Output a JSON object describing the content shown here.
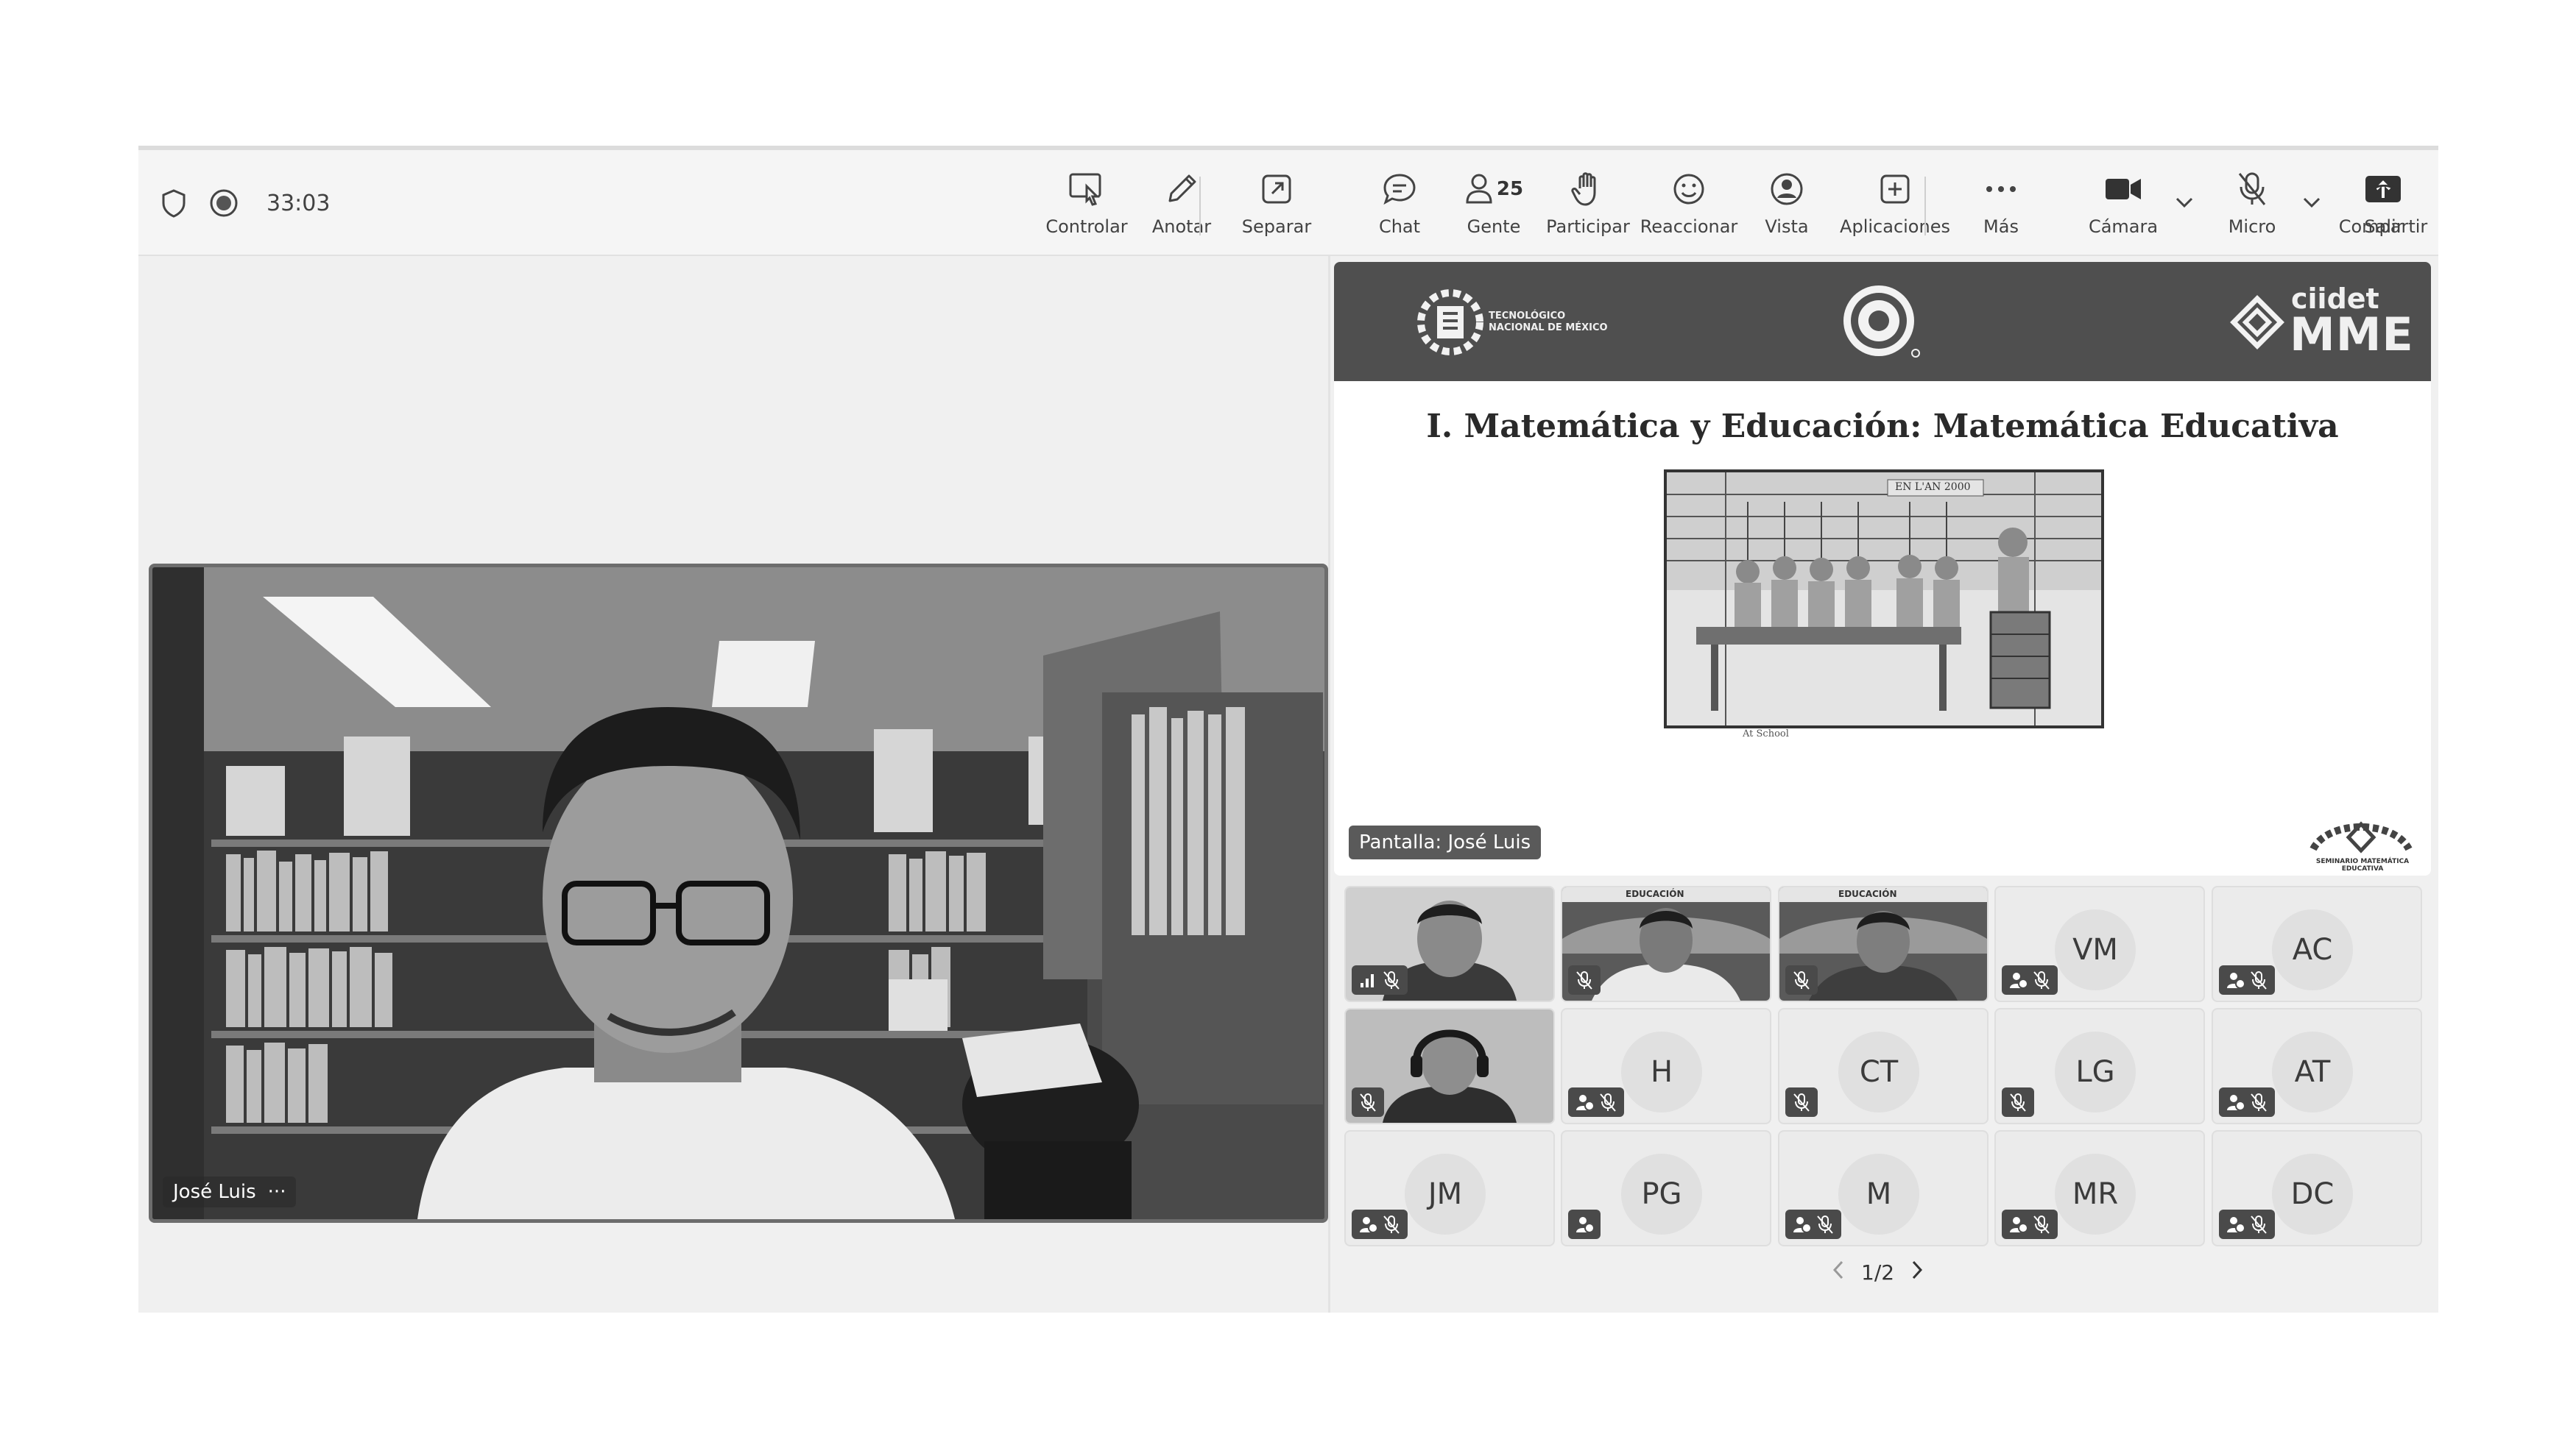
{
  "toolbar": {
    "timer": "33:03",
    "items": {
      "controlar": "Controlar",
      "anotar": "Anotar",
      "separar": "Separar",
      "chat": "Chat",
      "gente": "Gente",
      "gente_count": "25",
      "participar": "Participar",
      "reaccionar": "Reaccionar",
      "vista": "Vista",
      "aplicaciones": "Aplicaciones",
      "mas": "Más",
      "camara": "Cámara",
      "micro": "Micro",
      "compartir": "Compartir",
      "salir": "Salir"
    }
  },
  "main_video": {
    "participant_name": "José Luis",
    "more": "···"
  },
  "slide": {
    "title": "I. Matemática y Educación: Matemática Educativa",
    "header_left": "TECNOLÓGICO NACIONAL DE MÉXICO",
    "header_right_top": "ciidet",
    "header_right_bottom": "MME",
    "engraving_sign": "EN L'AN 2000",
    "caption": "At School",
    "footer_logo": "SEMINARIO MATEMÁTICA EDUCATIVA",
    "screen_tag": "Pantalla: José Luis",
    "banner_text": "EDUCACIÓN"
  },
  "participants": [
    {
      "initials": "VM"
    },
    {
      "initials": "AC"
    },
    {
      "initials": "H"
    },
    {
      "initials": "CT"
    },
    {
      "initials": "LG"
    },
    {
      "initials": "AT"
    },
    {
      "initials": "JM"
    },
    {
      "initials": "PG"
    },
    {
      "initials": "M"
    },
    {
      "initials": "MR"
    },
    {
      "initials": "DC"
    }
  ],
  "pager": {
    "label": "1/2"
  }
}
